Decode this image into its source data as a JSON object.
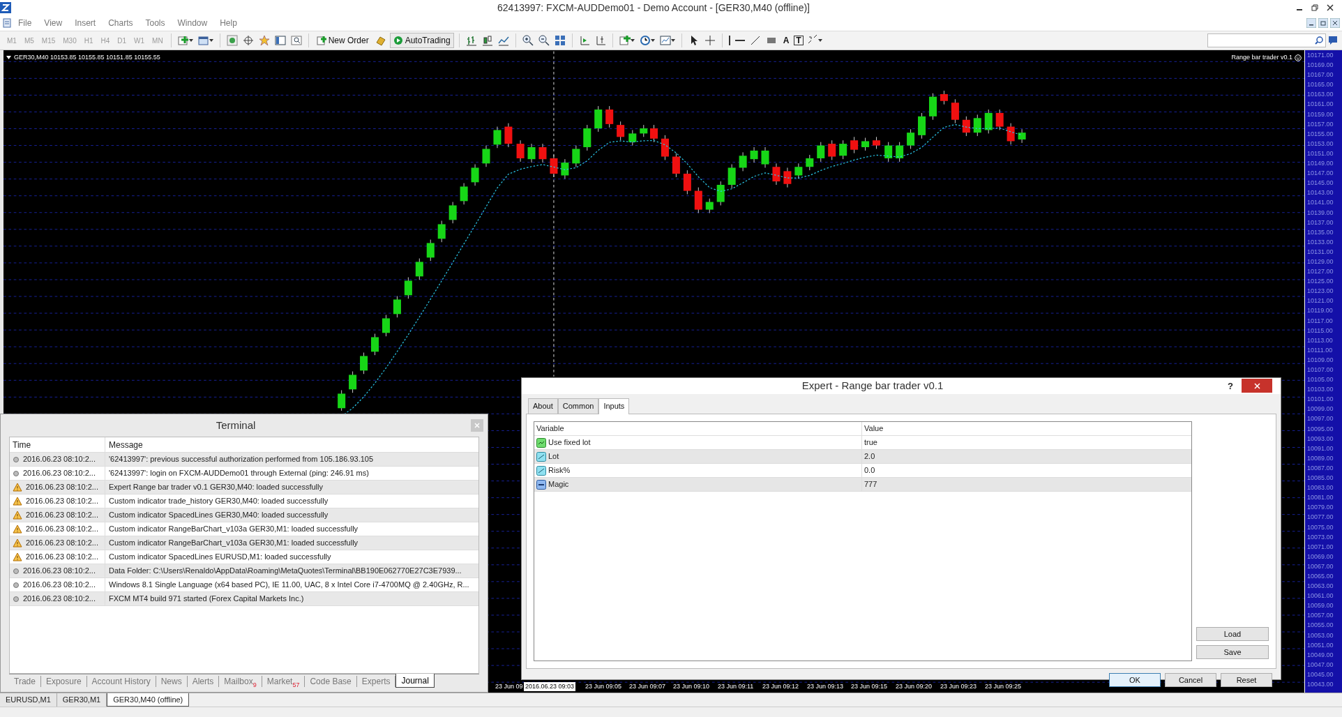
{
  "window": {
    "title": "62413997: FXCM-AUDDemo01 - Demo Account - [GER30,M40 (offline)]"
  },
  "menu": [
    "File",
    "View",
    "Insert",
    "Charts",
    "Tools",
    "Window",
    "Help"
  ],
  "toolbar": {
    "timeframes": [
      {
        "label": "M1",
        "disabled": true
      },
      {
        "label": "M5",
        "disabled": true
      },
      {
        "label": "M15",
        "disabled": true
      },
      {
        "label": "M30",
        "disabled": true
      },
      {
        "label": "H1",
        "disabled": true
      },
      {
        "label": "H4",
        "disabled": true
      },
      {
        "label": "D1",
        "disabled": true
      },
      {
        "label": "W1",
        "disabled": true
      },
      {
        "label": "MN",
        "disabled": true
      }
    ],
    "new_order": "New Order",
    "auto_trading": "AutoTrading",
    "text_tools": [
      "A",
      "T"
    ]
  },
  "chart": {
    "symbol_line": "GER30,M40  10153.85 10155.85 10151.85 10155.55",
    "expert_label": "Range bar trader v0.1",
    "price_axis": [
      "10171.00",
      "10169.00",
      "10167.00",
      "10165.00",
      "10163.00",
      "10161.00",
      "10159.00",
      "10157.00",
      "10155.00",
      "10153.00",
      "10151.00",
      "10149.00",
      "10147.00",
      "10145.00",
      "10143.00",
      "10141.00",
      "10139.00",
      "10137.00",
      "10135.00",
      "10133.00",
      "10131.00",
      "10129.00",
      "10127.00",
      "10125.00",
      "10123.00",
      "10121.00",
      "10119.00",
      "10117.00",
      "10115.00",
      "10113.00",
      "10111.00",
      "10109.00",
      "10107.00",
      "10105.00",
      "10103.00",
      "10101.00",
      "10099.00",
      "10097.00",
      "10095.00",
      "10093.00",
      "10091.00",
      "10089.00",
      "10087.00",
      "10085.00",
      "10083.00",
      "10081.00",
      "10079.00",
      "10077.00",
      "10075.00",
      "10073.00",
      "10071.00",
      "10069.00",
      "10067.00",
      "10065.00",
      "10063.00",
      "10061.00",
      "10059.00",
      "10057.00",
      "10055.00",
      "10053.00",
      "10051.00",
      "10049.00",
      "10047.00",
      "10045.00",
      "10043.00"
    ],
    "time_axis": [
      {
        "label": "23 Jun 09",
        "selected": false
      },
      {
        "label": "2016.06.23 09:03",
        "selected": true
      },
      {
        "label": "23 Jun 09:05",
        "selected": false
      },
      {
        "label": "23 Jun 09:07",
        "selected": false
      },
      {
        "label": "23 Jun 09:10",
        "selected": false
      },
      {
        "label": "23 Jun 09:11",
        "selected": false
      },
      {
        "label": "23 Jun 09:12",
        "selected": false
      },
      {
        "label": "23 Jun 09:13",
        "selected": false
      },
      {
        "label": "23 Jun 09:15",
        "selected": false
      },
      {
        "label": "23 Jun 09:20",
        "selected": false
      },
      {
        "label": "23 Jun 09:23",
        "selected": false
      },
      {
        "label": "23 Jun 09:25",
        "selected": false
      }
    ]
  },
  "terminal": {
    "title": "Terminal",
    "columns": [
      "Time",
      "Message"
    ],
    "rows": [
      {
        "kind": "info",
        "time": "2016.06.23 08:10:2...",
        "message": "'62413997': previous successful authorization performed from 105.186.93.105"
      },
      {
        "kind": "info",
        "time": "2016.06.23 08:10:2...",
        "message": "'62413997': login on FXCM-AUDDemo01 through External (ping: 246.91 ms)"
      },
      {
        "kind": "warning",
        "time": "2016.06.23 08:10:2...",
        "message": "Expert Range bar trader v0.1 GER30,M40: loaded successfully"
      },
      {
        "kind": "warning",
        "time": "2016.06.23 08:10:2...",
        "message": "Custom indicator trade_history  GER30,M40: loaded successfully"
      },
      {
        "kind": "warning",
        "time": "2016.06.23 08:10:2...",
        "message": "Custom indicator SpacedLines GER30,M40: loaded successfully"
      },
      {
        "kind": "warning",
        "time": "2016.06.23 08:10:2...",
        "message": "Custom indicator RangeBarChart_v103a GER30,M1: loaded successfully"
      },
      {
        "kind": "warning",
        "time": "2016.06.23 08:10:2...",
        "message": "Custom indicator RangeBarChart_v103a GER30,M1: loaded successfully"
      },
      {
        "kind": "warning",
        "time": "2016.06.23 08:10:2...",
        "message": "Custom indicator SpacedLines EURUSD,M1: loaded successfully"
      },
      {
        "kind": "info",
        "time": "2016.06.23 08:10:2...",
        "message": "Data Folder: C:\\Users\\Renaldo\\AppData\\Roaming\\MetaQuotes\\Terminal\\BB190E062770E27C3E7939..."
      },
      {
        "kind": "info",
        "time": "2016.06.23 08:10:2...",
        "message": "Windows 8.1 Single Language (x64 based PC), IE 11.00, UAC, 8 x Intel Core i7-4700MQ  @ 2.40GHz, R..."
      },
      {
        "kind": "info",
        "time": "2016.06.23 08:10:2...",
        "message": "FXCM MT4 build 971 started (Forex Capital Markets Inc.)"
      }
    ],
    "tabs": [
      {
        "label": "Trade",
        "selected": false
      },
      {
        "label": "Exposure",
        "selected": false
      },
      {
        "label": "Account History",
        "selected": false
      },
      {
        "label": "News",
        "selected": false
      },
      {
        "label": "Alerts",
        "selected": false
      },
      {
        "label": "Mailbox",
        "count": "9",
        "selected": false
      },
      {
        "label": "Market",
        "count": "57",
        "selected": false
      },
      {
        "label": "Code Base",
        "selected": false
      },
      {
        "label": "Experts",
        "selected": false
      },
      {
        "label": "Journal",
        "selected": true
      }
    ]
  },
  "dialog": {
    "title": "Expert - Range bar trader v0.1",
    "help": "?",
    "tabs": [
      {
        "label": "About",
        "selected": false
      },
      {
        "label": "Common",
        "selected": false
      },
      {
        "label": "Inputs",
        "selected": true
      }
    ],
    "columns": [
      "Variable",
      "Value"
    ],
    "inputs": [
      {
        "kind": "bool",
        "variable": "Use fixed lot",
        "value": "true"
      },
      {
        "kind": "double",
        "variable": "Lot",
        "value": "2.0"
      },
      {
        "kind": "double",
        "variable": "Risk%",
        "value": "0.0"
      },
      {
        "kind": "int",
        "variable": "Magic",
        "value": "777"
      }
    ],
    "side_buttons": [
      "Load",
      "Save"
    ],
    "buttons": [
      {
        "label": "OK",
        "default": true
      },
      {
        "label": "Cancel",
        "default": false
      },
      {
        "label": "Reset",
        "default": false
      }
    ]
  },
  "chart_tabs": [
    {
      "label": "EURUSD,M1",
      "selected": false
    },
    {
      "label": "GER30,M1",
      "selected": false
    },
    {
      "label": "GER30,M40 (offline)",
      "selected": true
    }
  ]
}
